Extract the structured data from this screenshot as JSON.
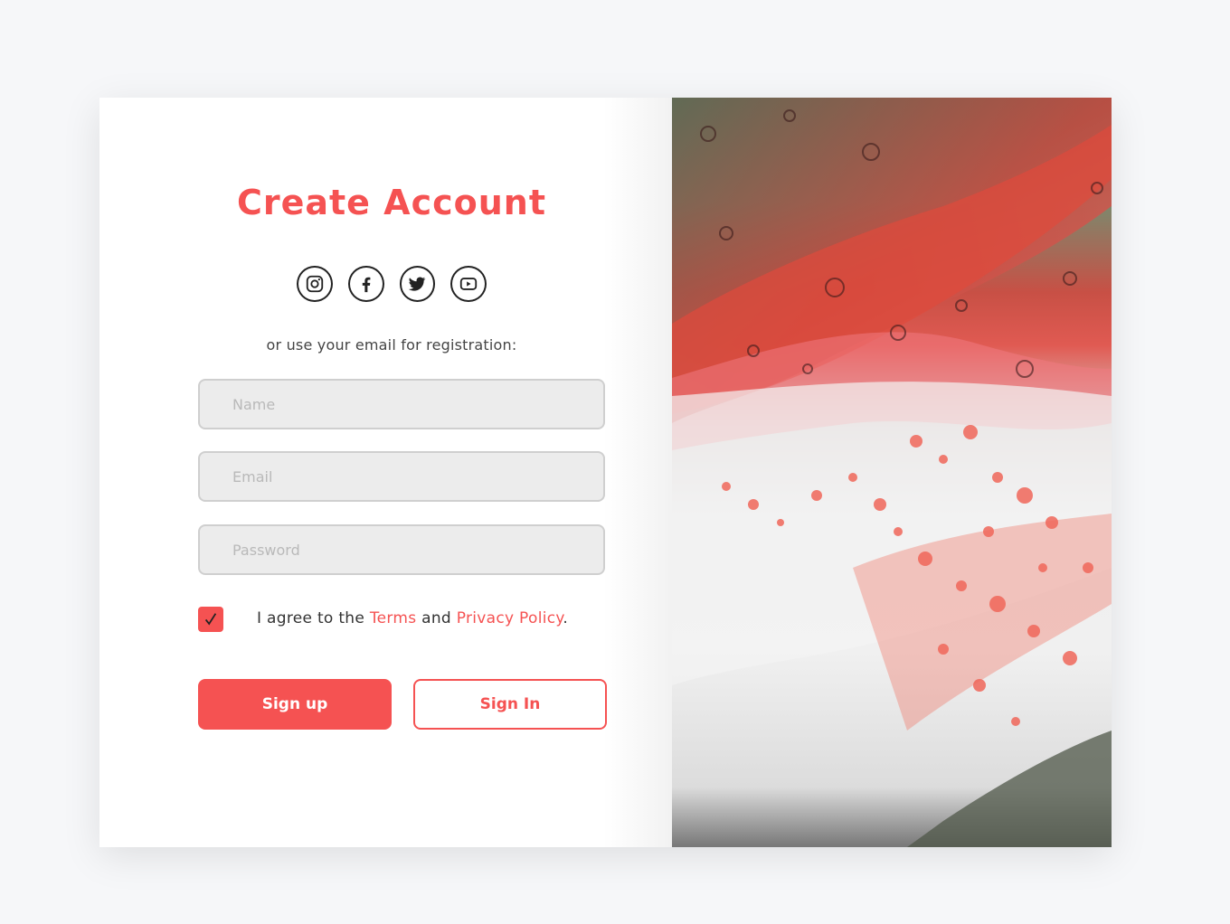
{
  "form": {
    "title": "Create Account",
    "subtitle": "or use your email for registration:",
    "name_placeholder": "Name",
    "email_placeholder": "Email",
    "password_placeholder": "Password",
    "agree_prefix": "I agree to the ",
    "terms_label": "Terms",
    "agree_middle": " and ",
    "privacy_label": "Privacy Policy",
    "agree_suffix": ".",
    "agree_checked": true,
    "signup_label": "Sign up",
    "signin_label": "Sign In"
  },
  "social": [
    "instagram-icon",
    "facebook-icon",
    "twitter-icon",
    "youtube-icon"
  ],
  "colors": {
    "accent": "#f55252",
    "background": "#f6f7f9",
    "field_bg": "#ececec",
    "field_border": "#cfcfcf"
  }
}
